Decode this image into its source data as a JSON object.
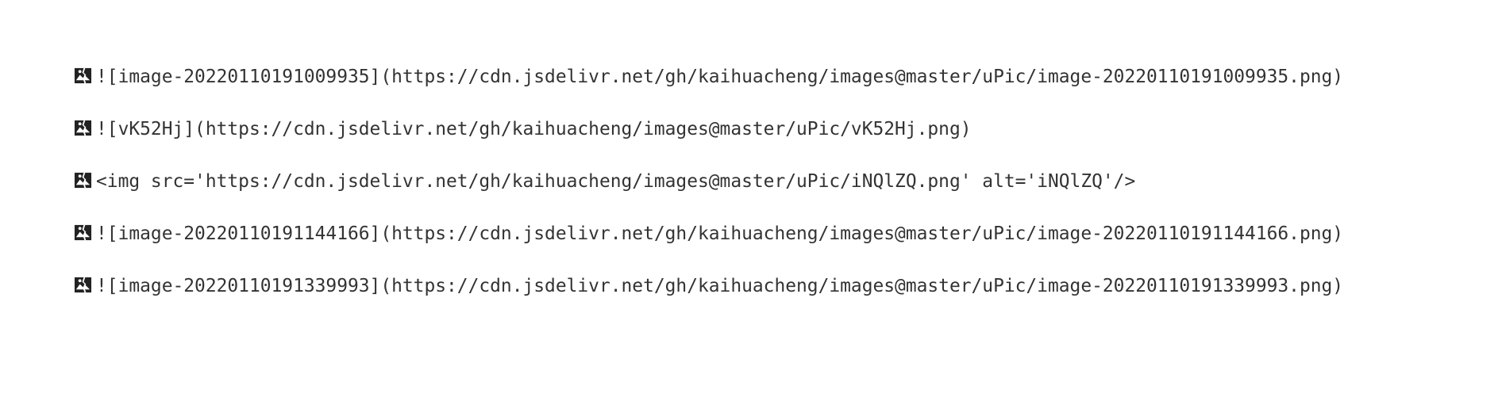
{
  "icons": {
    "broken_image": "broken-image-icon"
  },
  "paragraphs": [
    {
      "text": "![image-20220110191009935](https://cdn.jsdelivr.net/gh/kaihuacheng/images@master/uPic/image-20220110191009935.png)"
    },
    {
      "text": "![vK52Hj](https://cdn.jsdelivr.net/gh/kaihuacheng/images@master/uPic/vK52Hj.png)"
    },
    {
      "text": "<img src='https://cdn.jsdelivr.net/gh/kaihuacheng/images@master/uPic/iNQlZQ.png' alt='iNQlZQ'/>"
    },
    {
      "text": "![image-20220110191144166](https://cdn.jsdelivr.net/gh/kaihuacheng/images@master/uPic/image-20220110191144166.png)"
    },
    {
      "text": "![image-20220110191339993](https://cdn.jsdelivr.net/gh/kaihuacheng/images@master/uPic/image-20220110191339993.png)"
    }
  ]
}
